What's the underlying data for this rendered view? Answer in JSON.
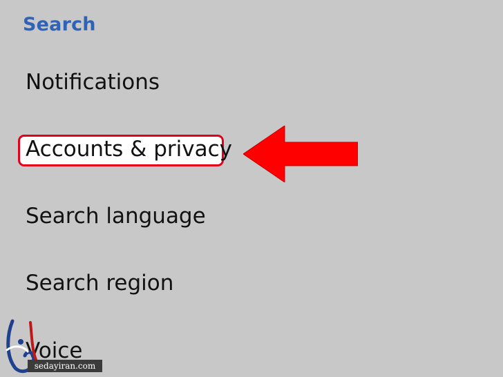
{
  "header": {
    "title": "Search"
  },
  "settings": {
    "items": [
      {
        "label": "Notifications"
      },
      {
        "label": "Accounts & privacy"
      },
      {
        "label": "Search language"
      },
      {
        "label": "Search region"
      },
      {
        "label": "Voice"
      }
    ]
  },
  "annotation": {
    "highlight_color": "#e3001b",
    "arrow_color": "#ff0000",
    "arrow_direction": "left"
  },
  "watermark": {
    "text": "sedayiran.com"
  },
  "colors": {
    "background": "#c8c8c8",
    "header_text": "#2f63b8",
    "item_text": "#111111"
  }
}
